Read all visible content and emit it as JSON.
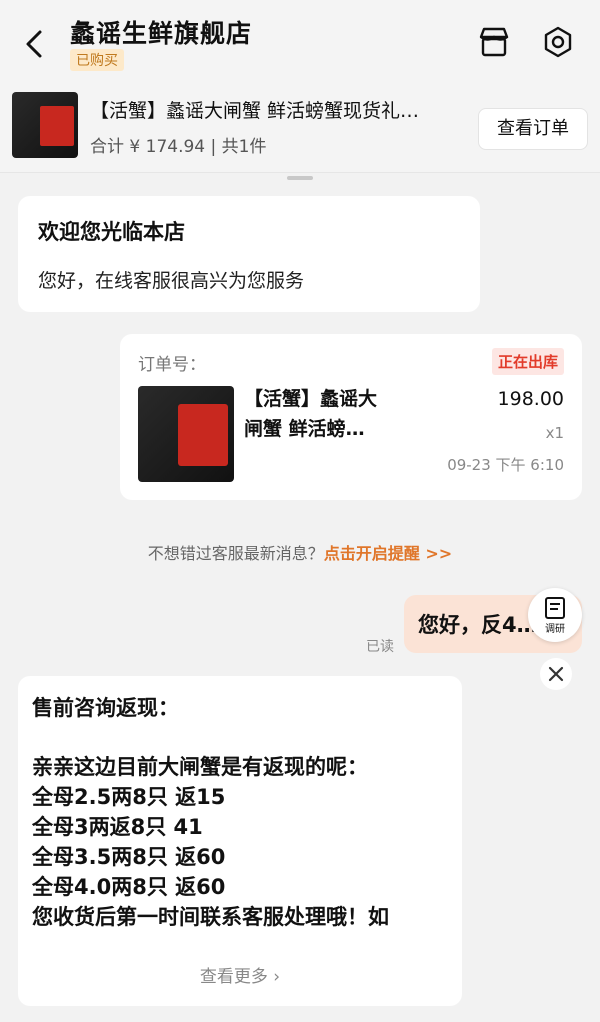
{
  "header": {
    "store_name": "蠡谣生鲜旗舰店",
    "purchased_badge": "已购买"
  },
  "order_bar": {
    "title": "【活蟹】蠡谣大闸蟹 鲜活螃蟹现货礼…",
    "total": "合计 ¥ 174.94 | 共1件",
    "view_order_label": "查看订单"
  },
  "welcome_card": {
    "title": "欢迎您光临本店",
    "text": "您好，在线客服很高兴为您服务"
  },
  "order_card": {
    "order_no_label": "订单号：",
    "status": "正在出库",
    "product_name": "【活蟹】蠡谣大闸蟹 鲜活螃…",
    "price": "198.00",
    "quantity": "x1",
    "time": "09-23 下午 6:10"
  },
  "reminder": {
    "text": "不想错过客服最新消息？",
    "link": "点击开启提醒 >>"
  },
  "my_message": {
    "text": "您好，反4…",
    "read_label": "已读"
  },
  "survey_label": "调研",
  "presale_card": {
    "title": "售前咨询返现：",
    "lines": [
      "亲亲这边目前大闸蟹是有返现的呢：",
      "全母2.5两8只 返15",
      "全母3两返8只 41",
      "全母3.5两8只 返60",
      "全母4.0两8只 返60",
      "您收货后第一时间联系客服处理哦！如"
    ],
    "view_more": "查看更多 ›"
  },
  "colors": {
    "accent_orange": "#e0762a",
    "status_red": "#e23b2a",
    "my_bubble": "#fbe3d6"
  }
}
